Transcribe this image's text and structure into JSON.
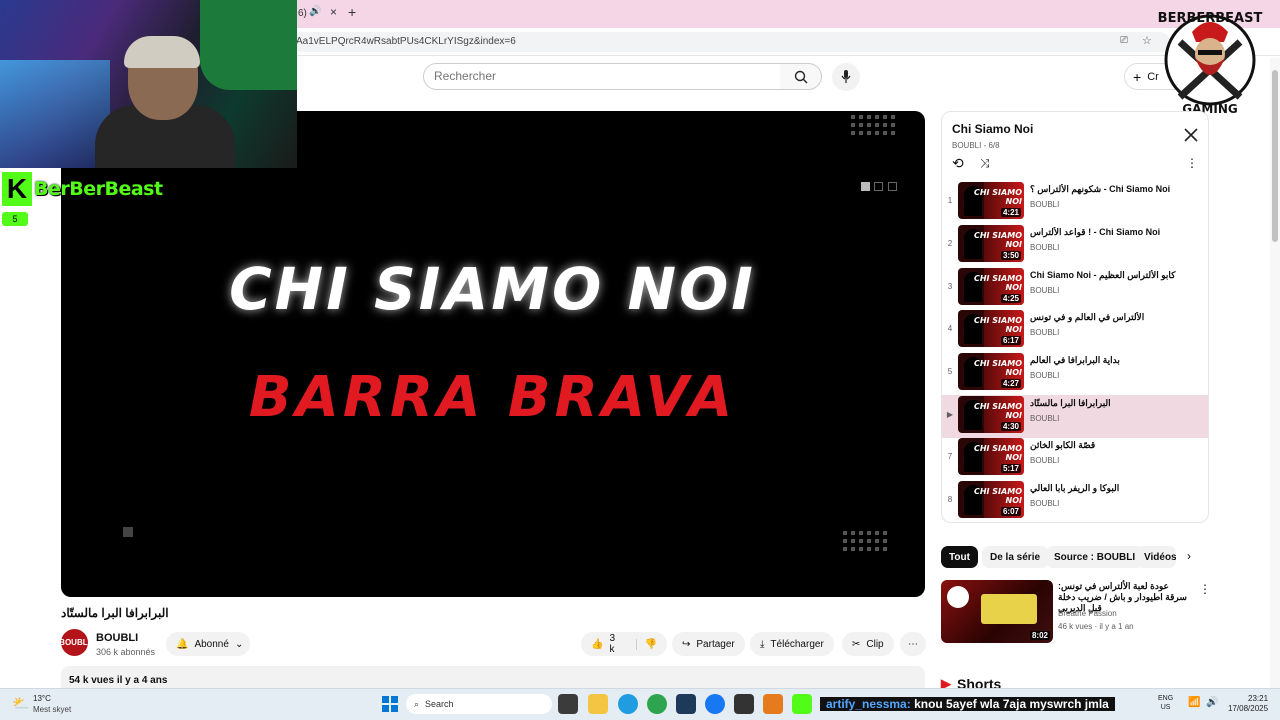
{
  "browser": {
    "tab_fragment": "6)",
    "new_tab": "+",
    "url": "Aa1vELPQrcR4wRsabtPUs4CKLrYISgz&index=6"
  },
  "youtube": {
    "search_placeholder": "Rechercher",
    "create_label": "Cr"
  },
  "overlay": {
    "streamer_name": "BerBerBeast",
    "viewer_count": "5",
    "logo_top": "BERBERBEAST",
    "logo_bottom": "GAMING"
  },
  "video": {
    "frame_line1": "CHI SIAMO NOI",
    "frame_line2": "BARRA BRAVA",
    "title": "البرابرافا البرا مالستّاد",
    "channel": "BOUBLI",
    "avatar_text": "BOUBLI",
    "subscribers": "306 k abonnés",
    "subscribed_label": "Abonné",
    "likes": "3 k",
    "share_label": "Partager",
    "download_label": "Télécharger",
    "clip_label": "Clip",
    "stats": "54 k vues  il y a 4 ans"
  },
  "playlist": {
    "title": "Chi Siamo Noi",
    "subtitle": "BOUBLI - 6/8",
    "items": [
      {
        "idx": "1",
        "title": "شكونهم الألتراس ؟ - Chi Siamo Noi",
        "channel": "BOUBLI",
        "duration": "4:21"
      },
      {
        "idx": "2",
        "title": "قواعد الألتراس ! - Chi Siamo Noi",
        "channel": "BOUBLI",
        "duration": "3:50"
      },
      {
        "idx": "3",
        "title": "Chi Siamo Noi - كابو الألتراس العظيم",
        "channel": "BOUBLI",
        "duration": "4:25"
      },
      {
        "idx": "4",
        "title": "الألتراس في العالم و في تونس",
        "channel": "BOUBLI",
        "duration": "6:17"
      },
      {
        "idx": "5",
        "title": "بداية البرابرافا في العالم",
        "channel": "BOUBLI",
        "duration": "4:27"
      },
      {
        "idx": "▶",
        "title": "البرابرافا البرا مالستّاد",
        "channel": "BOUBLI",
        "duration": "4:30"
      },
      {
        "idx": "7",
        "title": "قصّة الكابو الخائن",
        "channel": "BOUBLI",
        "duration": "5:17"
      },
      {
        "idx": "8",
        "title": "البوكا و الريفر بابا العالي",
        "channel": "BOUBLI",
        "duration": "6:07"
      }
    ],
    "thumb_text": "CHI SIAMO NOI"
  },
  "chips": [
    "Tout",
    "De la série",
    "Source : BOUBLI",
    "Vidéos"
  ],
  "recommended": {
    "title": "عودة لعبة الألتراس في تونس: سرقة اطيودار و باش / ضريب دخلة قبل الديربي",
    "channel": "Breathe Passion",
    "meta": "46 k vues · il y a 1 an",
    "duration": "8:02"
  },
  "shorts_label": "Shorts",
  "taskbar": {
    "temp": "13°C",
    "weather": "Mest skyet",
    "search": "Search",
    "chat_user": "artify_nessma:",
    "chat_message": "knou 5ayef wla 7aja myswrch jmla",
    "lang1": "ENG",
    "lang2": "US",
    "time": "23:21",
    "date": "17/08/2025"
  }
}
